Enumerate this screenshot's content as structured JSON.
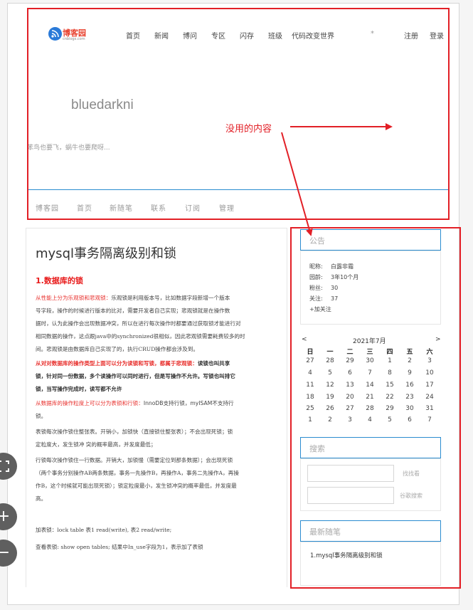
{
  "site": {
    "logo_text": "博客园",
    "logo_sub": "cnblogs.com",
    "nav": [
      "首页",
      "新闻",
      "博问",
      "专区",
      "闪存",
      "班级",
      "代码改变世界"
    ],
    "nav_star": "*",
    "register": "注册",
    "login": "登录"
  },
  "blog": {
    "title": "bluedarkni",
    "subtitle": "笨鸟也要飞，蜗牛也要爬呀...",
    "nav": [
      "博客园",
      "首页",
      "新随笔",
      "联系",
      "订阅",
      "管理"
    ]
  },
  "post": {
    "title": "mysql事务隔离级别和锁",
    "section1": "1.数据库的锁",
    "p1_red": "从性能上分为乐观锁和悲观锁：",
    "p1_lines": [
      "乐观锁是利用版本号，比如数据字段新增一个版本",
      "号字段，操作的时候进行版本的比对，需要开发者自己实现；悲观锁就是在操作数",
      "据时，认为此操作会出现数据冲突，所以在进行每次操作时都要通过获取锁才能进行对",
      "相同数据的操作，这点跟java中的synchronized很相似，因此悲观锁需要耗费较多的时",
      "间。悲观锁是由数据库自己实现了的，执行CRUD操作都会涉及到。"
    ],
    "p2_red_1": "从对对数据库的操作类型上面可以分为读锁和写锁，都属于悲观锁：",
    "p2_b1": "读锁也叫共享",
    "p2_b2": "锁，针对同一份数据，多个读操作可以同时进行，但是写操作不允许。写锁也叫排它",
    "p2_b3": "锁，当写操作完成时，读写都不允许",
    "p3_red": "从数据库的操作粒度上可以分为表锁和行锁：",
    "p3_rest": "InnoDB支持行锁，myISAM不支持行",
    "p3_line2": "锁。",
    "p4_lines": [
      "表锁每次操作锁住整张表。开销小，加锁快（直接锁住整张表）；不会出现死锁；锁",
      "定粒度大，发生锁冲 突的概率最高，并发度最低；"
    ],
    "p5_lines": [
      "行锁每次操作锁住一行数据。开销大，加锁慢（需要定位到那条数据）；会出现死锁",
      "（两个事务分别操作AB两条数据，事务一先操作B，再操作A，事务二先操作A，再操",
      "作B，这个时候就可能出现死锁）；锁定粒度最小，发生锁冲突的概率最低，并发度最",
      "高。"
    ],
    "p6": "加表锁：lock table 表1 read(write), 表2 read/write;",
    "p7": "查看表锁: show open tables;  结果中In_use字段为1，表示加了表锁"
  },
  "sidebar": {
    "notice_title": "公告",
    "info": [
      {
        "label": "昵称:",
        "value": "白露非霜"
      },
      {
        "label": "园龄:",
        "value": "3年10个月"
      },
      {
        "label": "粉丝:",
        "value": "30"
      },
      {
        "label": "关注:",
        "value": "37"
      }
    ],
    "follow": "+加关注",
    "calendar": {
      "prev": "<",
      "next": ">",
      "month": "2021年7月",
      "weekdays": [
        "日",
        "一",
        "二",
        "三",
        "四",
        "五",
        "六"
      ],
      "weeks": [
        [
          "27",
          "28",
          "29",
          "30",
          "1",
          "2",
          "3"
        ],
        [
          "4",
          "5",
          "6",
          "7",
          "8",
          "9",
          "10"
        ],
        [
          "11",
          "12",
          "13",
          "14",
          "15",
          "16",
          "17"
        ],
        [
          "18",
          "19",
          "20",
          "21",
          "22",
          "23",
          "24"
        ],
        [
          "25",
          "26",
          "27",
          "28",
          "29",
          "30",
          "31"
        ],
        [
          "1",
          "2",
          "3",
          "4",
          "5",
          "6",
          "7"
        ]
      ]
    },
    "search_title": "搜索",
    "search_btn": "找找看",
    "google_btn": "谷歌搜索",
    "latest_title": "最新随笔",
    "latest_item": "1.mysql事务隔离级别和锁"
  },
  "annotation": {
    "text": "没用的内容",
    "color": "#e21f26"
  },
  "controls": {
    "fit": "⛶",
    "zoom_in": "+",
    "zoom_out": "−"
  }
}
